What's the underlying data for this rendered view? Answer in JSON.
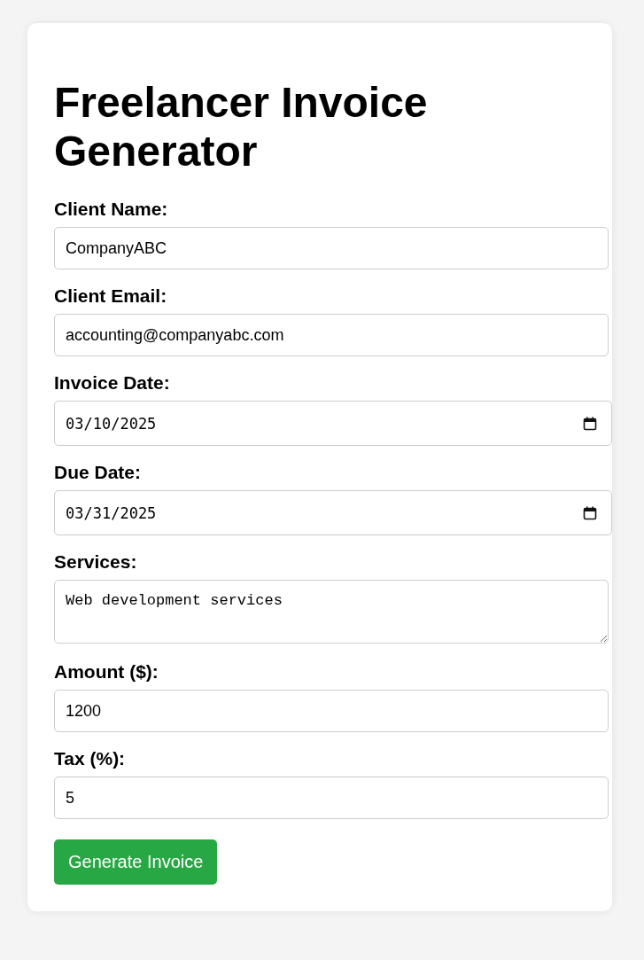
{
  "title": "Freelancer Invoice Generator",
  "fields": [
    {
      "label": "Client Name:",
      "kind": "text",
      "value": "CompanyABC"
    },
    {
      "label": "Client Email:",
      "kind": "text",
      "value": "accounting@companyabc.com"
    },
    {
      "label": "Invoice Date:",
      "kind": "date",
      "value": "03/10/2025"
    },
    {
      "label": "Due Date:",
      "kind": "date",
      "value": "03/31/2025"
    },
    {
      "label": "Services:",
      "kind": "textarea",
      "value": "Web development services"
    },
    {
      "label": "Amount ($):",
      "kind": "text",
      "value": "1200"
    },
    {
      "label": "Tax (%):",
      "kind": "text",
      "value": "5"
    }
  ],
  "button": "Generate Invoice"
}
